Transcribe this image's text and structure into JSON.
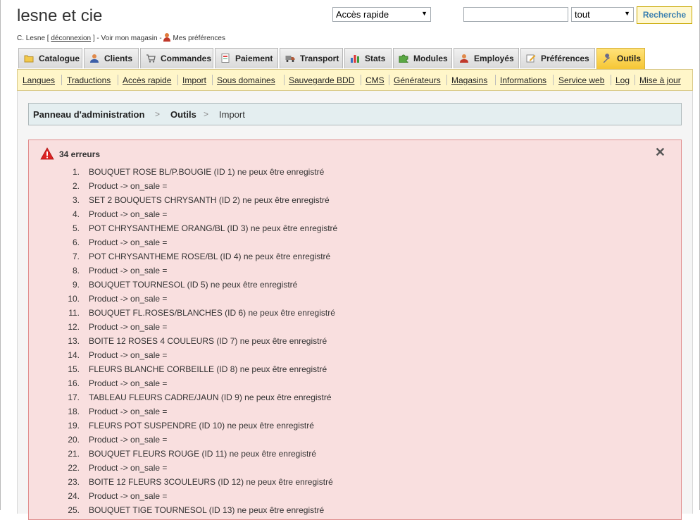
{
  "header": {
    "shop_name": "lesne et cie",
    "quick_access": "Accès rapide",
    "search_value": "",
    "scope": "tout",
    "search_button": "Recherche"
  },
  "userbar": {
    "user": "C. Lesne [",
    "logout": "déconnexion",
    "after_logout": "] - Voir mon magasin -",
    "preferences": "Mes préférences"
  },
  "tabs": [
    {
      "label": "Catalogue",
      "icon": "folder-icon"
    },
    {
      "label": "Clients",
      "icon": "user-icon"
    },
    {
      "label": "Commandes",
      "icon": "cart-icon"
    },
    {
      "label": "Paiement",
      "icon": "invoice-icon"
    },
    {
      "label": "Transport",
      "icon": "truck-icon"
    },
    {
      "label": "Stats",
      "icon": "bar-chart-icon"
    },
    {
      "label": "Modules",
      "icon": "puzzle-icon"
    },
    {
      "label": "Employés",
      "icon": "employee-icon"
    },
    {
      "label": "Préférences",
      "icon": "edit-icon"
    },
    {
      "label": "Outils",
      "icon": "wrench-icon",
      "active": true
    }
  ],
  "subnav": [
    "Langues",
    "Traductions",
    "Accès rapide",
    "Import",
    "Sous domaines",
    "Sauvegarde BDD",
    "CMS",
    "Générateurs",
    "Magasins",
    "Informations",
    "Service web",
    "Log",
    "Mise à jour"
  ],
  "breadcrumb": [
    "Panneau d'administration",
    "Outils",
    "Import"
  ],
  "errors": {
    "title": "34 erreurs",
    "items": [
      "BOUQUET ROSE BL/P.BOUGIE (ID 1) ne peux être enregistré",
      "Product -> on_sale =",
      "SET 2 BOUQUETS CHRYSANTH (ID 2) ne peux être enregistré",
      "Product -> on_sale =",
      "POT CHRYSANTHEME ORANG/BL (ID 3) ne peux être enregistré",
      "Product -> on_sale =",
      "POT CHRYSANTHEME ROSE/BL (ID 4) ne peux être enregistré",
      "Product -> on_sale =",
      "BOUQUET TOURNESOL (ID 5) ne peux être enregistré",
      "Product -> on_sale =",
      "BOUQUET FL.ROSES/BLANCHES (ID 6) ne peux être enregistré",
      "Product -> on_sale =",
      "BOITE 12 ROSES 4 COULEURS (ID 7) ne peux être enregistré",
      "Product -> on_sale =",
      "FLEURS BLANCHE CORBEILLE (ID 8) ne peux être enregistré",
      "Product -> on_sale =",
      "TABLEAU FLEURS CADRE/JAUN (ID 9) ne peux être enregistré",
      "Product -> on_sale =",
      "FLEURS POT SUSPENDRE (ID 10) ne peux être enregistré",
      "Product -> on_sale =",
      "BOUQUET FLEURS ROUGE (ID 11) ne peux être enregistré",
      "Product -> on_sale =",
      "BOITE 12 FLEURS 3COULEURS (ID 12) ne peux être enregistré",
      "Product -> on_sale =",
      "BOUQUET TIGE TOURNESOL (ID 13) ne peux être enregistré"
    ]
  }
}
